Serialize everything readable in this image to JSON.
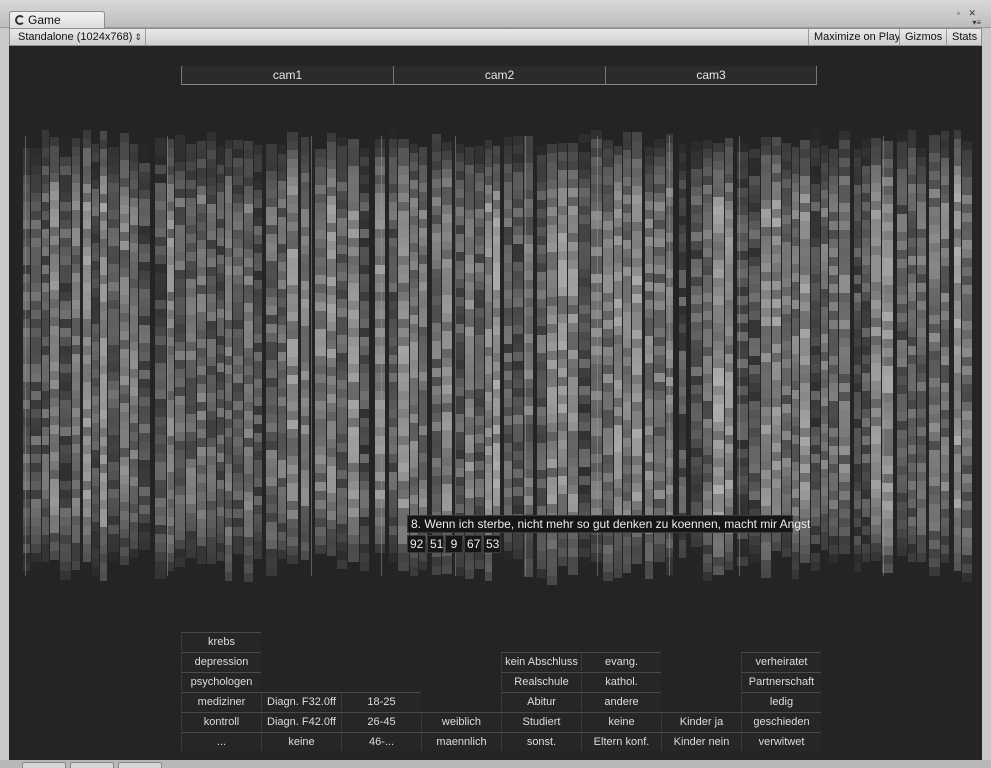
{
  "window": {
    "tab_title": "Game",
    "icon": "unity-logo-icon",
    "controls": "▫ ✕",
    "menu": "▾≡"
  },
  "toolbar": {
    "resolution": "Standalone (1024x768)",
    "resolution_arrow": "⇕",
    "maximize_label": "Maximize on Play",
    "gizmos_label": "Gizmos",
    "stats_label": "Stats"
  },
  "cameras": [
    "cam1",
    "cam2",
    "cam3"
  ],
  "tooltip": {
    "question": "8. Wenn ich sterbe, nicht mehr so gut denken zu koennen, macht mir Angst",
    "values": [
      "92",
      "51",
      "9",
      "67",
      "53"
    ]
  },
  "filters": {
    "group": [
      "krebs",
      "depression",
      "psychologen",
      "mediziner",
      "kontroll",
      "..."
    ],
    "diagnosis": [
      "Diagn. F32.0ff",
      "Diagn. F42.0ff",
      "keine"
    ],
    "age": [
      "18-25",
      "26-45",
      "46-..."
    ],
    "gender": [
      "weiblich",
      "maennlich"
    ],
    "education": [
      "kein Abschluss",
      "Realschule",
      "Abitur",
      "Studiert",
      "sonst."
    ],
    "religion": [
      "evang.",
      "kathol.",
      "andere",
      "keine",
      "Eltern konf."
    ],
    "children": [
      "Kinder ja",
      "Kinder nein"
    ],
    "marital": [
      "verheiratet",
      "Partnerschaft",
      "ledig",
      "geschieden",
      "verwitwet"
    ]
  },
  "colors": {
    "background": "#242424",
    "bar_light": "#bdbdbd",
    "bar_dark": "#2a2a2a"
  }
}
